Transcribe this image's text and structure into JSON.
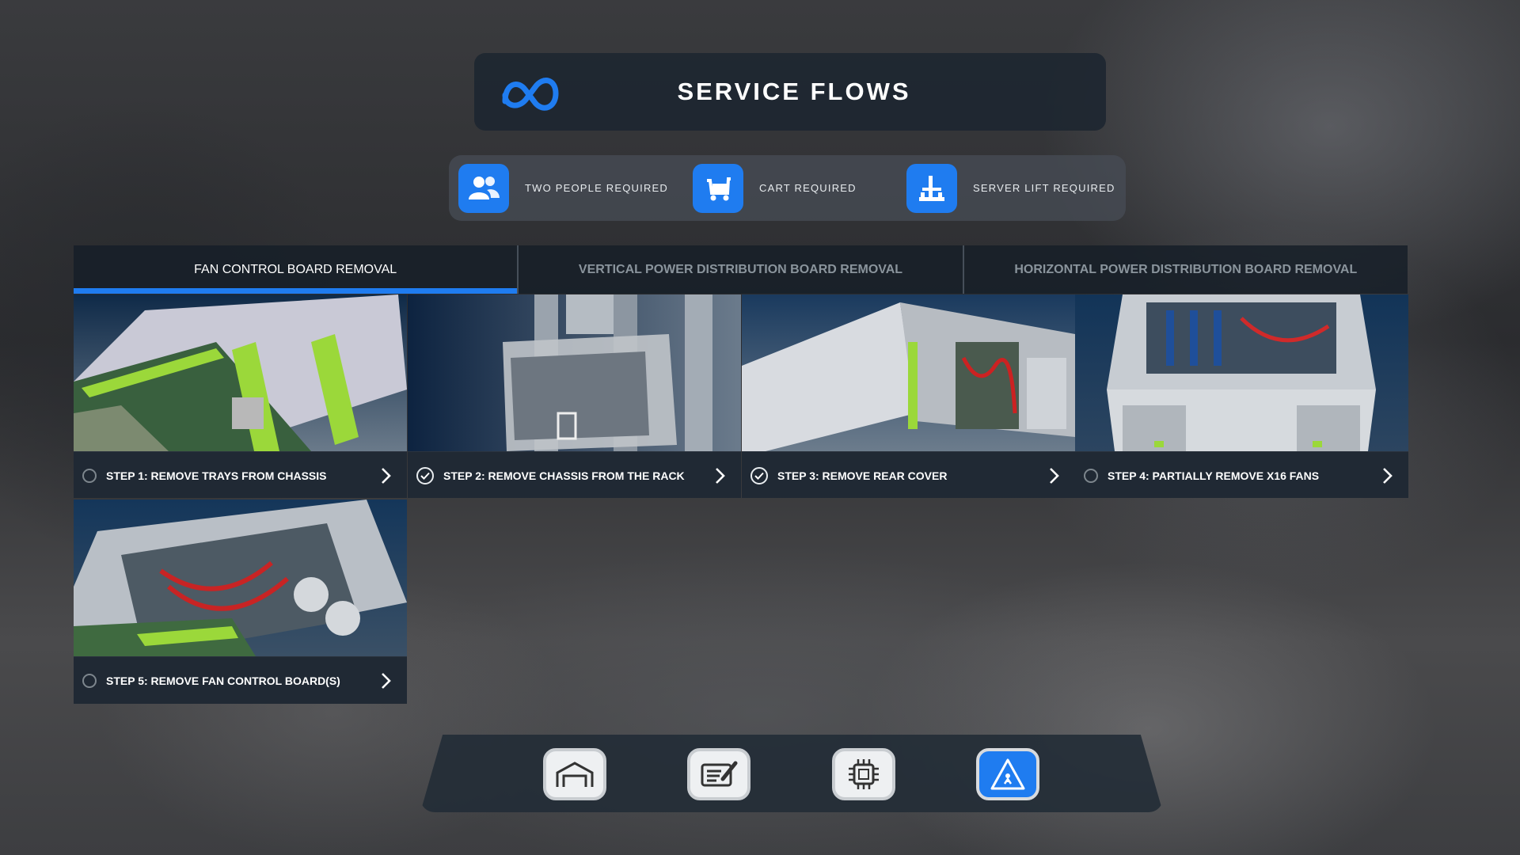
{
  "header": {
    "title": "SERVICE FLOWS",
    "logo_icon": "meta-logo-icon"
  },
  "requirements": [
    {
      "label": "TWO PEOPLE REQUIRED",
      "icon": "people-icon"
    },
    {
      "label": "CART REQUIRED",
      "icon": "cart-icon"
    },
    {
      "label": "SERVER LIFT REQUIRED",
      "icon": "server-lift-icon"
    }
  ],
  "tabs": [
    {
      "label": "FAN CONTROL BOARD REMOVAL",
      "active": true
    },
    {
      "label": "VERTICAL POWER DISTRIBUTION BOARD REMOVAL",
      "active": false
    },
    {
      "label": "HORIZONTAL POWER DISTRIBUTION BOARD REMOVAL",
      "active": false
    }
  ],
  "steps": [
    {
      "label": "STEP 1: REMOVE TRAYS FROM CHASSIS",
      "completed": false
    },
    {
      "label": "STEP 2: REMOVE CHASSIS FROM THE RACK",
      "completed": true
    },
    {
      "label": "STEP 3: REMOVE REAR COVER",
      "completed": true
    },
    {
      "label": "STEP 4: PARTIALLY REMOVE X16 FANS",
      "completed": false
    },
    {
      "label": "STEP 5: REMOVE FAN CONTROL BOARD(S)",
      "completed": false
    }
  ],
  "dock": [
    {
      "icon": "hangar-icon",
      "active": false
    },
    {
      "icon": "notes-icon",
      "active": false
    },
    {
      "icon": "chip-icon",
      "active": false
    },
    {
      "icon": "safety-warning-icon",
      "active": true
    }
  ],
  "colors": {
    "accent": "#1f7cf0",
    "panel": "#1c2630"
  }
}
